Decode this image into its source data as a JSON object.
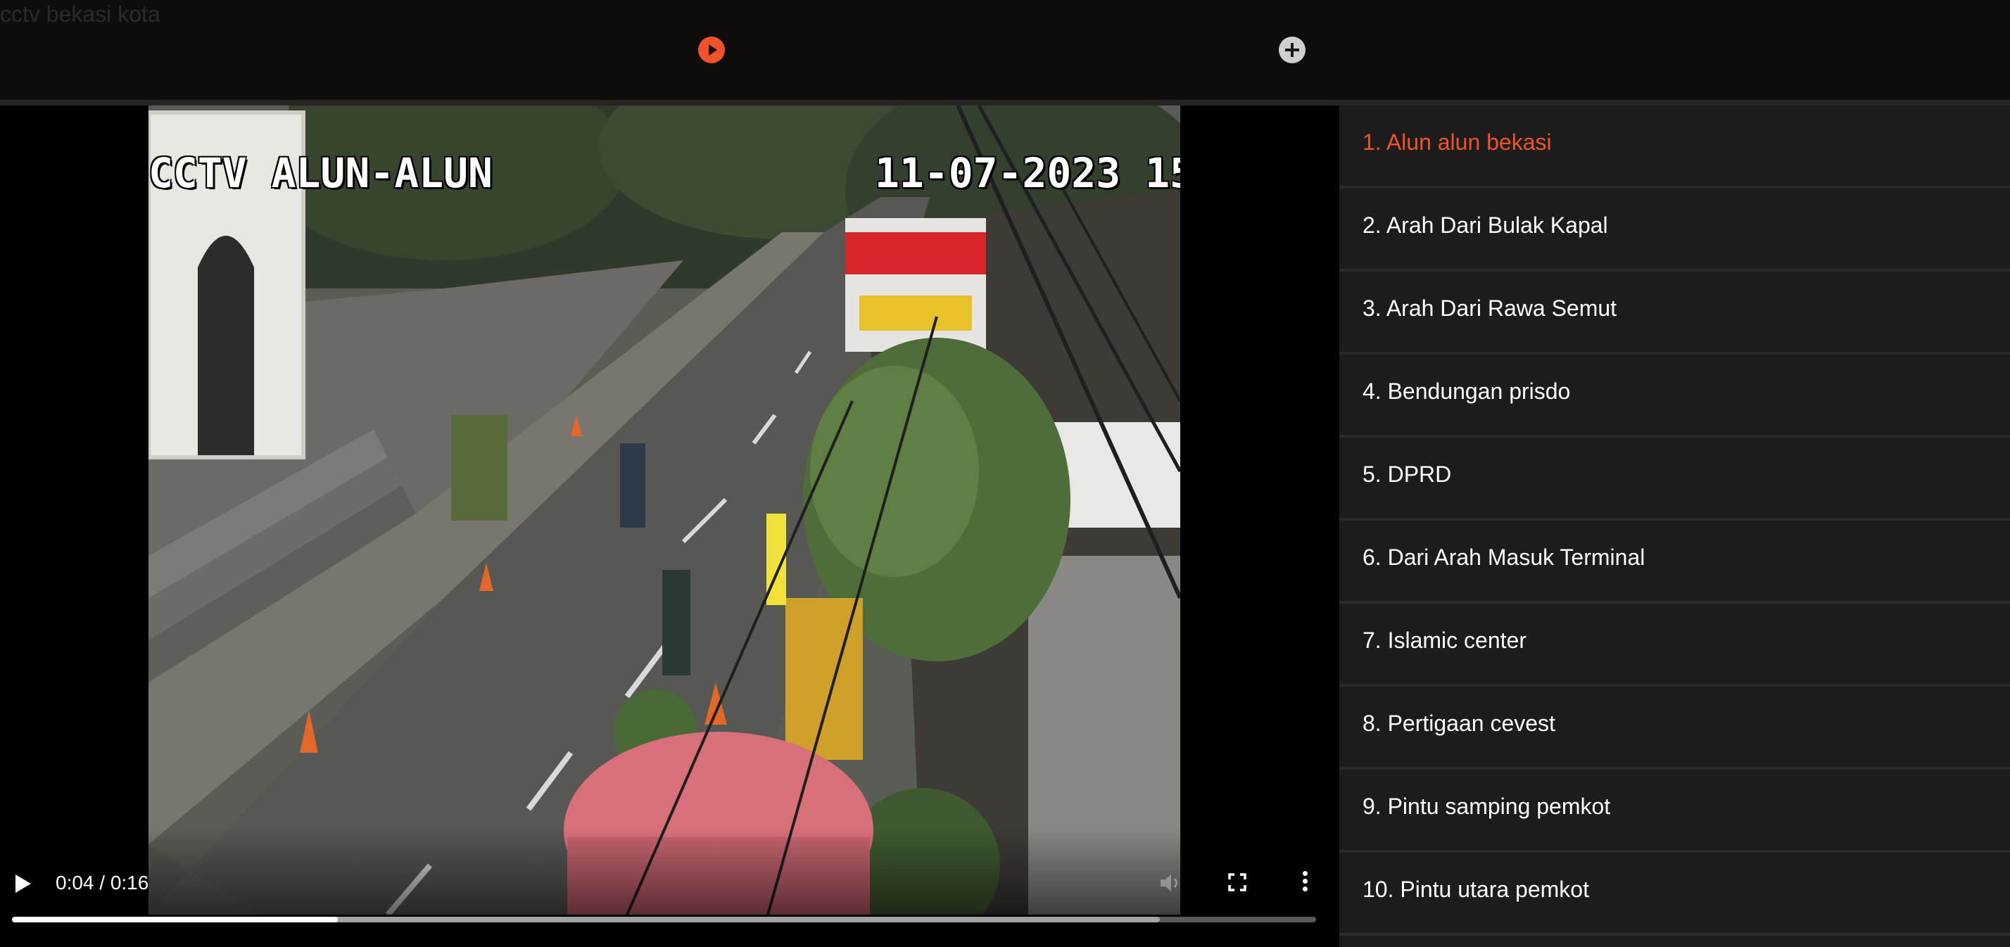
{
  "app": {
    "title": "cctv bekasi kota"
  },
  "toolbar": {
    "play_icon": "play-circle-icon",
    "add_icon": "plus-circle-icon",
    "accent_color": "#f0522b"
  },
  "video": {
    "overlay_camera_label": "CCTV ALUN-ALUN",
    "overlay_timestamp": "11-07-2023 15",
    "time_display": "0:04 / 0:16",
    "current_time_seconds": 4,
    "duration_seconds": 16,
    "buffered_fraction": 0.88
  },
  "playlist": {
    "active_index": 0,
    "items": [
      {
        "label": "1. Alun alun bekasi"
      },
      {
        "label": "2. Arah Dari Bulak Kapal"
      },
      {
        "label": "3. Arah Dari Rawa Semut"
      },
      {
        "label": "4. Bendungan prisdo"
      },
      {
        "label": "5. DPRD"
      },
      {
        "label": "6. Dari Arah Masuk Terminal"
      },
      {
        "label": "7. Islamic center"
      },
      {
        "label": "8. Pertigaan cevest"
      },
      {
        "label": "9. Pintu samping pemkot"
      },
      {
        "label": "10. Pintu utara pemkot"
      }
    ]
  }
}
